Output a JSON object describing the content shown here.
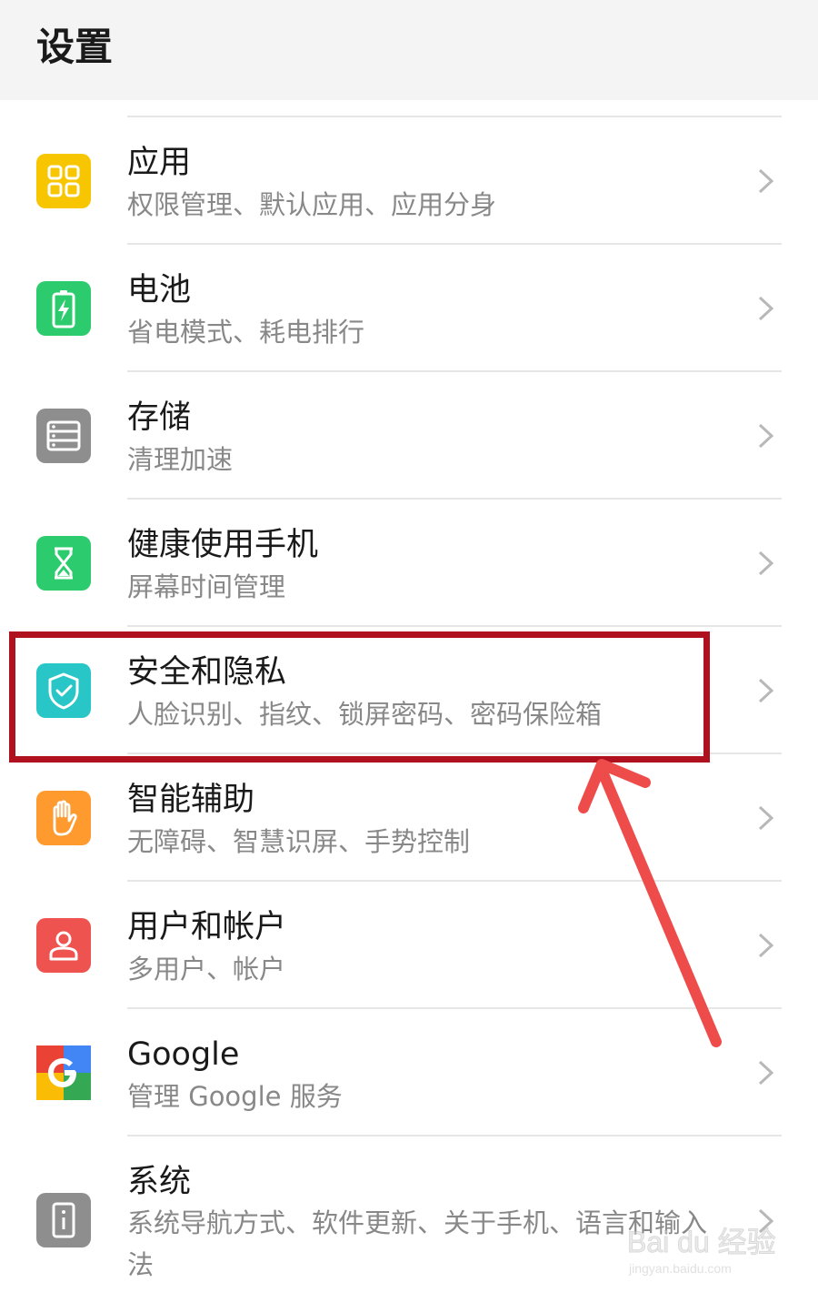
{
  "header": {
    "title": "设置"
  },
  "rows": [
    {
      "title": "应用",
      "subtitle": "权限管理、默认应用、应用分身",
      "icon": "apps-icon",
      "icon_color": "#f7c600"
    },
    {
      "title": "电池",
      "subtitle": "省电模式、耗电排行",
      "icon": "battery-icon",
      "icon_color": "#2ccc6e"
    },
    {
      "title": "存储",
      "subtitle": "清理加速",
      "icon": "storage-icon",
      "icon_color": "#8e8e8e"
    },
    {
      "title": "健康使用手机",
      "subtitle": "屏幕时间管理",
      "icon": "hourglass-icon",
      "icon_color": "#2ccc6e"
    },
    {
      "title": "安全和隐私",
      "subtitle": "人脸识别、指纹、锁屏密码、密码保险箱",
      "icon": "shield-icon",
      "icon_color": "#28c6c6"
    },
    {
      "title": "智能辅助",
      "subtitle": "无障碍、智慧识屏、手势控制",
      "icon": "hand-icon",
      "icon_color": "#ff9a2e"
    },
    {
      "title": "用户和帐户",
      "subtitle": "多用户、帐户",
      "icon": "user-icon",
      "icon_color": "#ef5350"
    },
    {
      "title": "Google",
      "subtitle": "管理 Google 服务",
      "icon": "google-icon",
      "icon_color": "#4285f4"
    },
    {
      "title": "系统",
      "subtitle": "系统导航方式、软件更新、关于手机、语言和输入法",
      "icon": "system-info-icon",
      "icon_color": "#8e8e8e"
    }
  ],
  "annotation": {
    "highlight_color": "#b0111f",
    "arrow_color": "#ee4b4b"
  },
  "watermark": {
    "main": "Bai du 经验",
    "sub": "jingyan.baidu.com"
  }
}
